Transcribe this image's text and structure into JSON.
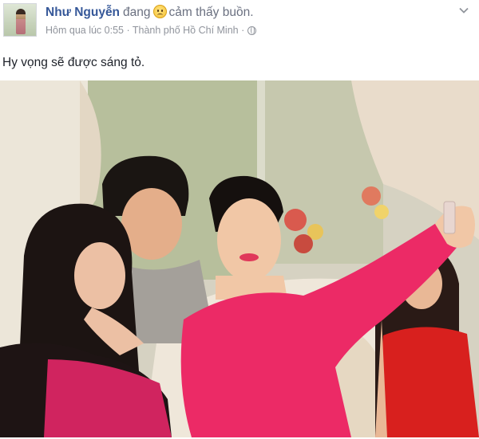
{
  "post": {
    "author": "Như Nguyễn",
    "verb": "đang",
    "feeling_icon": "sad-face-emoji",
    "feeling": "cảm thấy buồn.",
    "timestamp": "Hôm qua lúc 0:55",
    "separator": "·",
    "location": "Thành phố Hồ Chí Minh",
    "privacy_icon": "globe-icon",
    "caption": "Hy vọng sẽ được sáng tỏ.",
    "photo_description_icon": "group-selfie-photo"
  },
  "colors": {
    "author_link": "#365899",
    "meta_text": "#90949c",
    "body_text": "#1d2129"
  }
}
